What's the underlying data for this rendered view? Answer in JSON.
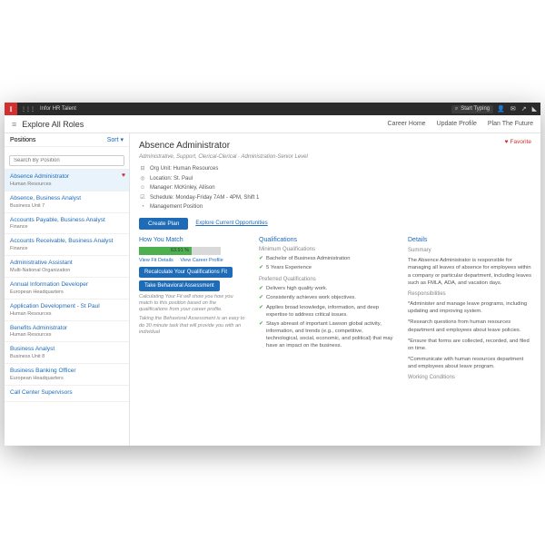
{
  "topbar": {
    "crumb": "Infor HR Talent",
    "search_placeholder": "Start Typing"
  },
  "subbar": {
    "title": "Explore All Roles",
    "links": [
      "Career Home",
      "Update Profile",
      "Plan The Future"
    ]
  },
  "sidebar": {
    "header": "Positions",
    "sort": "Sort",
    "search_placeholder": "Search By Position",
    "items": [
      {
        "title": "Absence Administrator",
        "sub": "Human Resources",
        "sel": true,
        "fav": true
      },
      {
        "title": "Absence, Business Analyst",
        "sub": "Business Unit 7"
      },
      {
        "title": "Accounts Payable, Business Analyst",
        "sub": "Finance"
      },
      {
        "title": "Accounts Receivable, Business Analyst",
        "sub": "Finance"
      },
      {
        "title": "Administrative Assistant",
        "sub": "Multi-National Organization"
      },
      {
        "title": "Annual Information Developer",
        "sub": "European Headquarters"
      },
      {
        "title": "Application Development - St Paul",
        "sub": "Human Resources"
      },
      {
        "title": "Benefits Administrator",
        "sub": "Human Resources"
      },
      {
        "title": "Business Analyst",
        "sub": "Business Unit 8"
      },
      {
        "title": "Business Banking Officer",
        "sub": "European Headquarters"
      },
      {
        "title": "Call Center Supervisors",
        "sub": ""
      }
    ]
  },
  "role": {
    "title": "Absence Administrator",
    "subtitle": "Administrative, Support, Clerical-Clerical · Administration-Senior Level",
    "favorite": "Favorite",
    "meta": {
      "org": "Org Unit: Human Resources",
      "loc": "Location: St. Paul",
      "mgr": "Manager: McKinley, Allison",
      "sched": "Schedule: Monday-Friday 7AM - 4PM, Shift 1",
      "mgmt": "Management Position"
    },
    "create_plan": "Create Plan",
    "explore": "Explore Current Opportunities"
  },
  "match": {
    "heading": "How You Match",
    "pct": "63.91 %",
    "pct_val": 63.91,
    "view_fit": "View Fit Details",
    "view_profile": "View Career Profile",
    "recalc": "Recalculate Your Qualifications Fit",
    "behav": "Take Behavioral Assessment",
    "note1": "Calculating Your Fit will show you how you match to this position based on the qualifications from your career profile.",
    "note2": "Taking the Behavioral Assessment is an easy to do 30 minute task that will provide you with an individual"
  },
  "quals": {
    "heading": "Qualifications",
    "min_h": "Minimum Qualifications",
    "min": [
      "Bachelor of Business Administration",
      "5 Years Experience"
    ],
    "pref_h": "Preferred Qualifications",
    "pref": [
      "Delivers high quality work.",
      "Consistently achieves work objectives.",
      "Applies broad knowledge, information, and deep expertise to address critical issues.",
      "Stays abreast of important Lawson global activity, information, and trends (e.g., competitive, technological, social, economic, and political) that may have an impact on the business."
    ]
  },
  "details": {
    "heading": "Details",
    "sum_h": "Summary",
    "summary": "The Absence Administrator is responsible for managing all leaves of absence for employees within a company or particular department, including leaves such as FMLA, ADA, and vacation days.",
    "resp_h": "Responsibilities",
    "resp": [
      "*Administer and manage leave programs, including updating and improving system.",
      "*Research questions from human resources department and employees about leave policies.",
      "*Ensure that forms are collected, recorded, and filed on time.",
      "*Communicate with human resources department and employees about leave program."
    ],
    "work_h": "Working Conditions"
  }
}
